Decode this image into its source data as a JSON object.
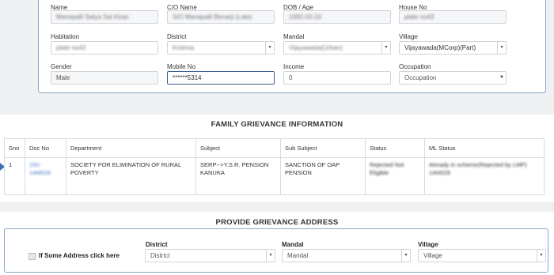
{
  "applicant": {
    "name": {
      "label": "Name",
      "value": "Manepalli Satya Sai Kiran"
    },
    "co_name": {
      "label": "C/O Name",
      "value": "S/O Manepalli Benarji (Late)"
    },
    "dob": {
      "label": "DOB / Age",
      "value": "1992-03-10"
    },
    "house_no": {
      "label": "House No",
      "value": "plate no43"
    },
    "habitation": {
      "label": "Habitation",
      "value": "plate no43"
    },
    "district": {
      "label": "District",
      "value": "Krishna"
    },
    "mandal": {
      "label": "Mandal",
      "value": "Vijayawada(Urban)"
    },
    "village": {
      "label": "Village",
      "value": "Vijayawada(MCorp)(Part)"
    },
    "gender": {
      "label": "Gender",
      "value": "Male"
    },
    "mobile": {
      "label": "Mobile No",
      "value": "******5314"
    },
    "income": {
      "label": "Income",
      "value": "0"
    },
    "occupation": {
      "label": "Occupation",
      "value": "Occupation"
    }
  },
  "family_grievance": {
    "title": "FAMILY GRIEVANCE INFORMATION",
    "columns": [
      "Sno",
      "Doc No",
      "Department",
      "Subject",
      "Sub Subject",
      "Status",
      "ML Status"
    ],
    "rows": [
      {
        "sno": "1",
        "doc_no": "150-14M029",
        "department": "SOCIETY FOR ELIMINATION OF RURAL POVERTY",
        "subject": "SERP-->Y.S.R. PENSION KANUKA",
        "sub_subject": "SANCTION OF OAP PENSION",
        "status": "Rejected Not Eligible",
        "ml_status": "Already in scheme(Rejected by LMP) 1AN029"
      }
    ]
  },
  "grievance_address": {
    "title": "PROVIDE GRIEVANCE ADDRESS",
    "checkbox_label": "If Some Address click here",
    "district": {
      "label": "District",
      "placeholder": "District"
    },
    "mandal": {
      "label": "Mandal",
      "placeholder": "Mandal"
    },
    "village": {
      "label": "Village",
      "placeholder": "Village"
    }
  },
  "colors": {
    "accent_border": "#8aa6c8",
    "link_blue": "#4a78c9",
    "arrow": "#3c6fb4"
  }
}
